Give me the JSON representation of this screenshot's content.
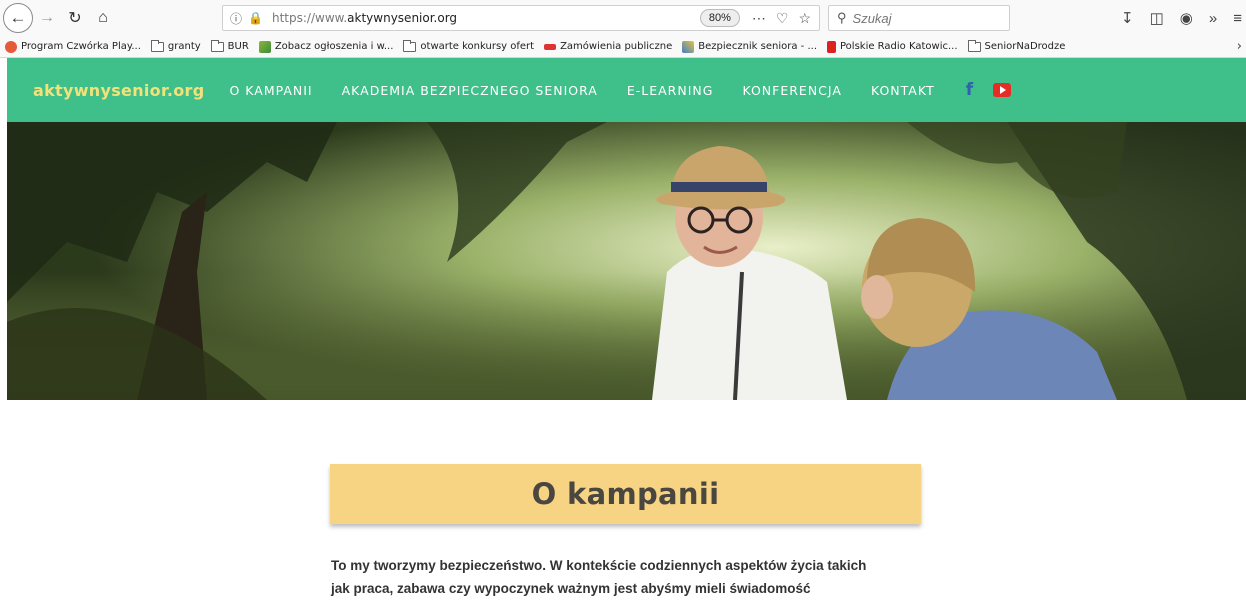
{
  "browser": {
    "url_prefix": "https://www.",
    "url_domain": "aktywnysenior.org",
    "zoom": "80%",
    "search_placeholder": "Szukaj"
  },
  "bookmarks": [
    {
      "label": "Program Czwórka Play...",
      "icon": "radio-icon",
      "color": "#e45b3a"
    },
    {
      "label": "granty",
      "icon": "folder-icon"
    },
    {
      "label": "BUR",
      "icon": "folder-icon"
    },
    {
      "label": "Zobacz ogłoszenia i w...",
      "icon": "pen-icon",
      "color": "#8bb83c"
    },
    {
      "label": "otwarte konkursy ofert",
      "icon": "folder-icon"
    },
    {
      "label": "Zamówienia publiczne",
      "icon": "eagle-icon",
      "color": "#d33"
    },
    {
      "label": "Bezpiecznik seniora - ...",
      "icon": "puzzle-icon",
      "color": "#3c7fd0"
    },
    {
      "label": "Polskie Radio Katowic...",
      "icon": "flag-icon",
      "color": "#d22"
    },
    {
      "label": "SeniorNaDrodze",
      "icon": "folder-icon"
    }
  ],
  "site": {
    "logo": "aktywnysenior.org",
    "nav": [
      "O KAMPANII",
      "AKADEMIA BEZPIECZNEGO SENIORA",
      "E-LEARNING",
      "KONFERENCJA",
      "KONTAKT"
    ],
    "facebook": "f",
    "colors": {
      "nav_bg": "#3fbf89",
      "logo": "#f3e27a",
      "title_box": "#f7d384"
    }
  },
  "content": {
    "title": "O kampanii",
    "paragraph_lines": [
      "To my tworzymy bezpieczeństwo. W kontekście codziennych aspektów życia takich",
      "jak praca, zabawa czy wypoczynek ważnym jest abyśmy mieli świadomość"
    ]
  }
}
